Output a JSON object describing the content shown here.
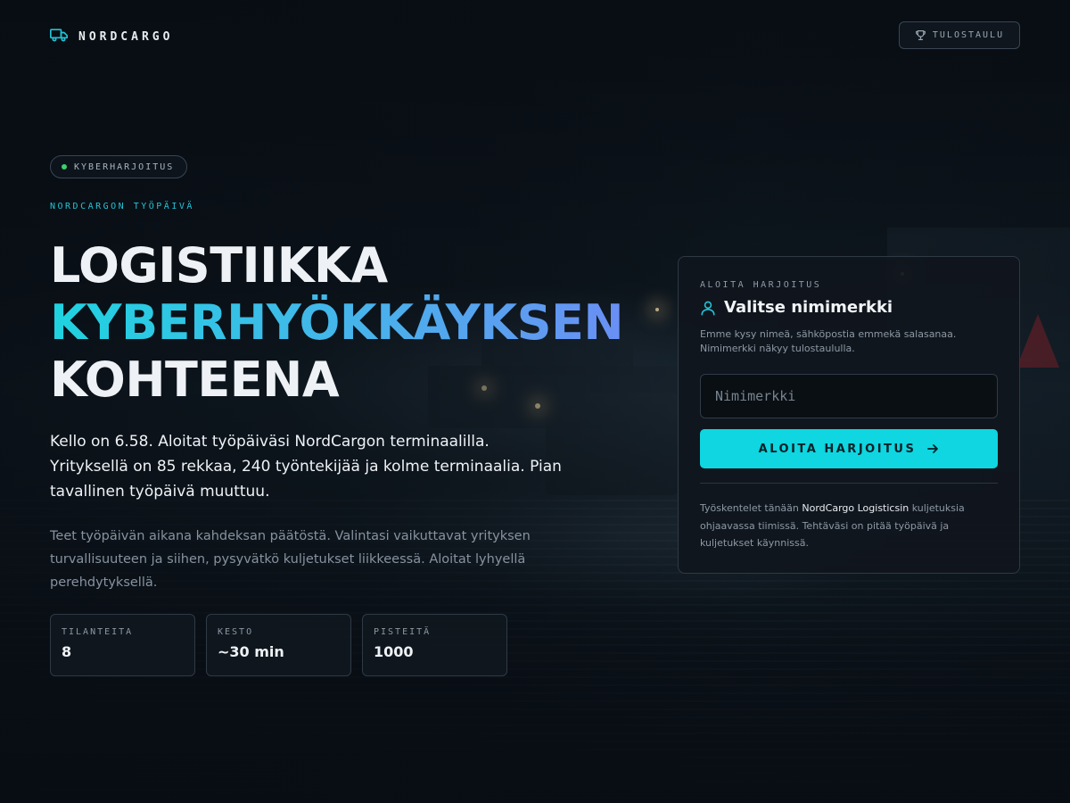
{
  "brand": {
    "name": "NORDCARGO",
    "icon": "truck-icon"
  },
  "header": {
    "leaderboard_label": "TULOSTAULU",
    "leaderboard_icon": "trophy-icon"
  },
  "hero": {
    "badge": "KYBERHARJOITUS",
    "eyebrow": "NORDCARGON TYÖPÄIVÄ",
    "title_line1": "LOGISTIIKKA",
    "title_line2": "KYBERHYÖKKÄYKSEN",
    "title_line3": "KOHTEENA",
    "lead": "Kello on 6.58. Aloitat työpäiväsi NordCargon terminaalilla. Yrityksellä on 85 rekkaa, 240 työntekijää ja kolme terminaalia. Pian tavallinen työpäivä muuttuu.",
    "sub": "Teet työpäivän aikana kahdeksan päätöstä. Valintasi vaikuttavat yrityksen turvallisuuteen ja siihen, pysyvätkö kuljetukset liikkeessä. Aloitat lyhyellä perehdytyksellä."
  },
  "stats": [
    {
      "label": "TILANTEITA",
      "value": "8"
    },
    {
      "label": "KESTO",
      "value": "~30 min"
    },
    {
      "label": "PISTEITÄ",
      "value": "1000"
    }
  ],
  "card": {
    "kicker": "ALOITA HARJOITUS",
    "title": "Valitse nimimerkki",
    "description": "Emme kysy nimeä, sähköpostia emmekä salasanaa. Nimimerkki näkyy tulostaululla.",
    "input_placeholder": "Nimimerkki",
    "input_value": "",
    "button_label": "ALOITA HARJOITUS",
    "footer_prefix": "Työskentelet tänään ",
    "footer_company": "NordCargo Logisticsin",
    "footer_suffix": " kuljetuksia ohjaavassa tiimissä. Tehtäväsi on pitää työpäivä ja kuljetukset käynnissä."
  },
  "colors": {
    "accent": "#0fd6e0",
    "status_dot": "#3ecf6a",
    "eyebrow": "#22c3d6"
  }
}
